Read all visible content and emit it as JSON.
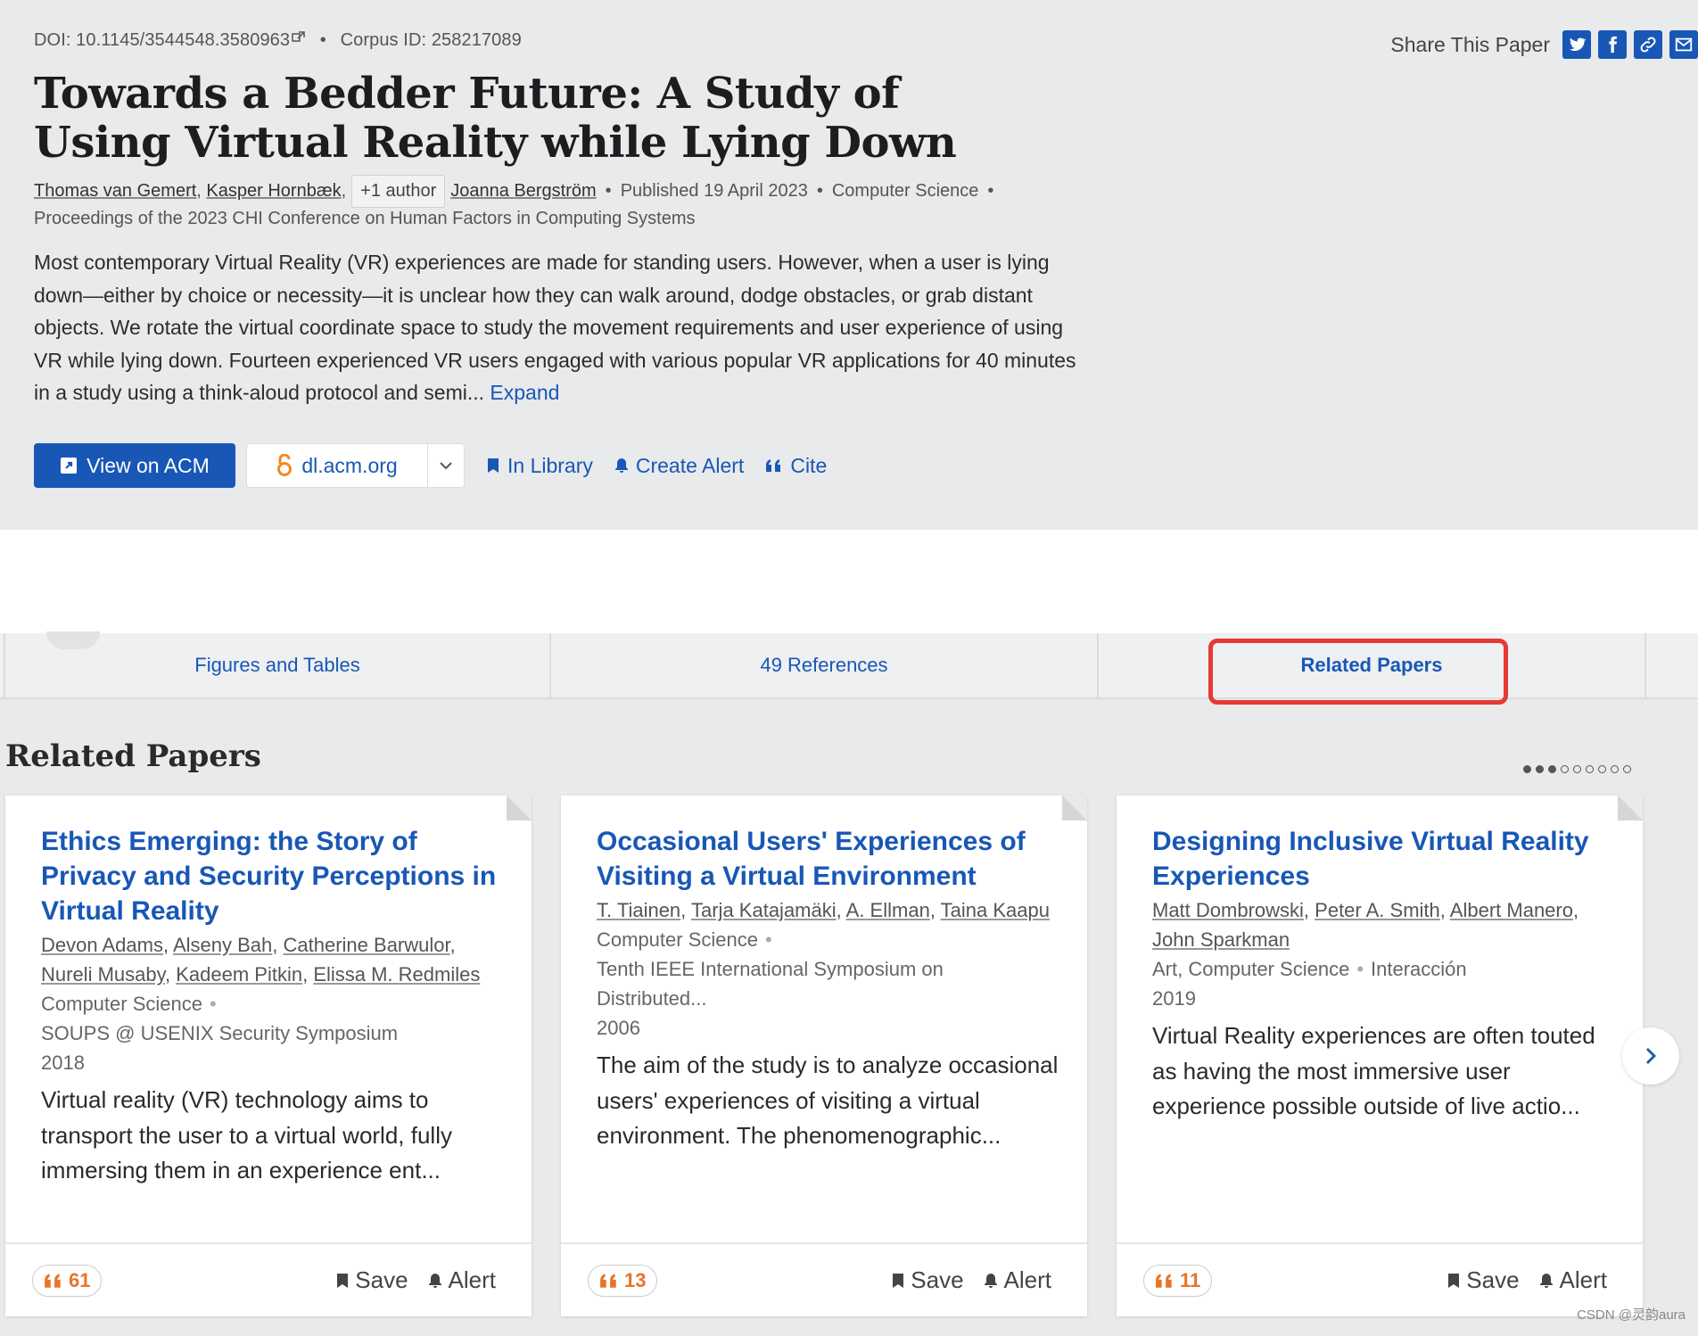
{
  "header": {
    "doi": "DOI: 10.1145/3544548.3580963",
    "corpus": "Corpus ID: 258217089",
    "share_label": "Share This Paper",
    "title": "Towards a Bedder Future: A Study of Using Virtual Reality while Lying Down",
    "authors": [
      "Thomas van Gemert",
      "Kasper Hornbæk",
      "Joanna Bergström"
    ],
    "more_authors": "+1 author",
    "published": "Published 19 April 2023",
    "field": "Computer Science",
    "venue": "Proceedings of the 2023 CHI Conference on Human Factors in Computing Systems",
    "abstract": "Most contemporary Virtual Reality (VR) experiences are made for standing users. However, when a user is lying down—either by choice or necessity—it is unclear how they can walk around, dodge obstacles, or grab distant objects. We rotate the virtual coordinate space to study the movement requirements and user experience of using VR while lying down. Fourteen experienced VR users engaged with various popular VR applications for 40 minutes in a study using a think-aloud protocol and semi...",
    "expand": "Expand"
  },
  "actions": {
    "view": "View on ACM",
    "source": "dl.acm.org",
    "library": "In Library",
    "alert": "Create Alert",
    "cite": "Cite"
  },
  "tabs": [
    "Figures and Tables",
    "49 References",
    "Related Papers"
  ],
  "related": {
    "title": "Related Papers",
    "cards": [
      {
        "title": "Ethics Emerging: the Story of Privacy and Security Perceptions in Virtual Reality",
        "authors": [
          "Devon Adams",
          "Alseny Bah",
          "Catherine Barwulor",
          "Nureli Musaby",
          "Kadeem Pitkin",
          "Elissa M. Redmiles"
        ],
        "field": "Computer Science",
        "venue": "SOUPS @ USENIX Security Symposium",
        "year": "2018",
        "abstract": "Virtual reality (VR) technology aims to transport the user to a virtual world, fully immersing them in an experience ent...",
        "citations": "61",
        "save": "Save",
        "alert": "Alert"
      },
      {
        "title": "Occasional Users' Experiences of Visiting a Virtual Environment",
        "authors": [
          "T. Tiainen",
          "Tarja Katajamäki",
          "A. Ellman",
          "Taina Kaapu"
        ],
        "field": "Computer Science",
        "venue": "Tenth IEEE International Symposium on Distributed...",
        "year": "2006",
        "abstract": "The aim of the study is to analyze occasional users' experiences of visiting a virtual environment. The phenomenographic...",
        "citations": "13",
        "save": "Save",
        "alert": "Alert"
      },
      {
        "title": "Designing Inclusive Virtual Reality Experiences",
        "authors": [
          "Matt Dombrowski",
          "Peter A. Smith",
          "Albert Manero",
          "John Sparkman"
        ],
        "field": "Art, Computer Science",
        "field2": "Interacción",
        "year": "2019",
        "abstract": "Virtual Reality experiences are often touted as having the most immersive user experience possible outside of live actio...",
        "citations": "11",
        "save": "Save",
        "alert": "Alert"
      }
    ]
  },
  "watermark": "CSDN @灵韵aura",
  "colors": {
    "accent": "#1857b6",
    "highlight": "#e53935",
    "citation": "#e8742a"
  }
}
